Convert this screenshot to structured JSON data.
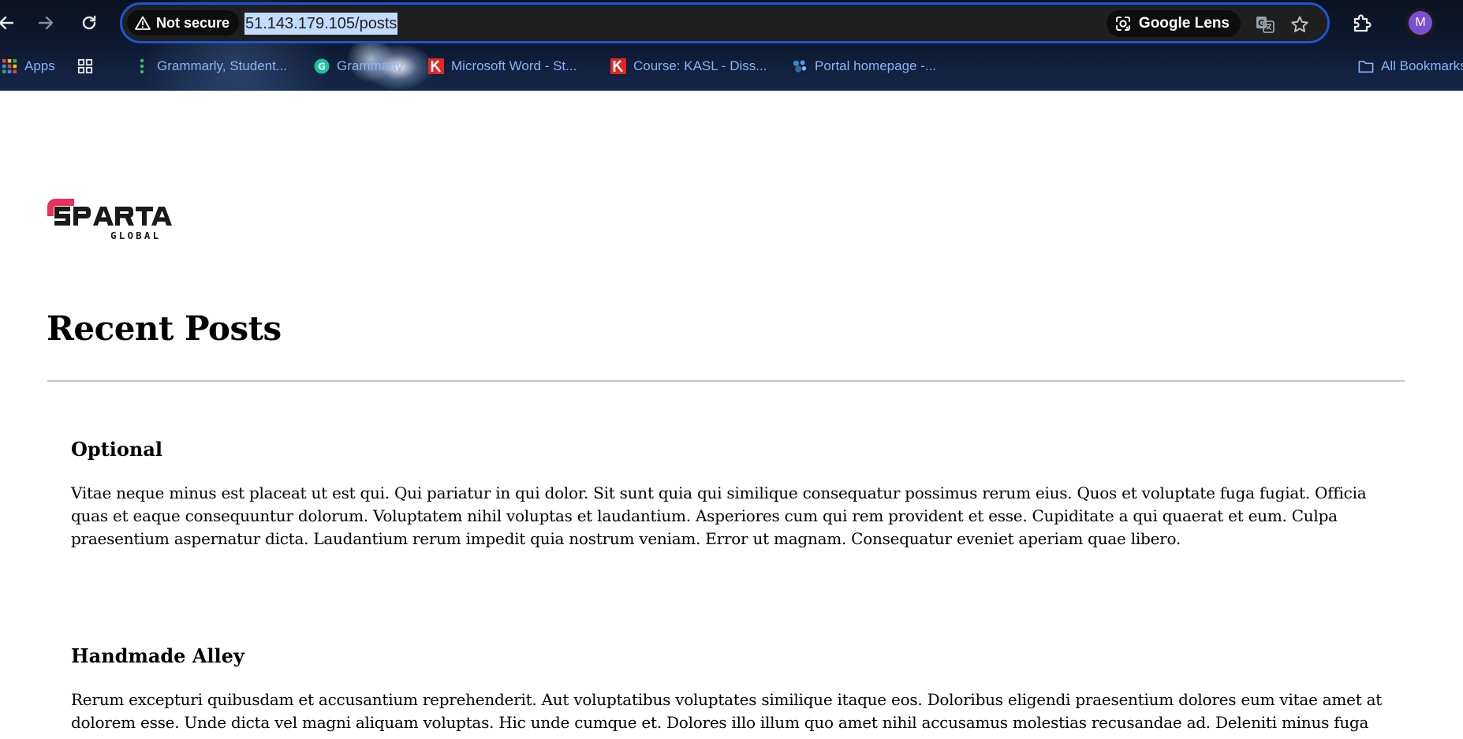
{
  "browser": {
    "security_label": "Not secure",
    "url": "51.143.179.105/posts",
    "lens_label": "Google Lens",
    "profile_initial": "M",
    "bookmarks": [
      {
        "label": "Apps"
      },
      {
        "label": ""
      },
      {
        "label": "Grammarly, Student..."
      },
      {
        "label": "Grammarly"
      },
      {
        "label": "Microsoft Word - St..."
      },
      {
        "label": "Course: KASL - Diss..."
      },
      {
        "label": "Portal homepage -..."
      },
      {
        "label": "All Bookmarks"
      }
    ]
  },
  "page": {
    "logo_alt": "SPARTA GLOBAL",
    "heading": "Recent Posts",
    "posts": [
      {
        "title": "Optional",
        "body": "Vitae neque minus est placeat ut est qui. Qui pariatur in qui dolor. Sit sunt quia qui similique consequatur possimus rerum eius. Quos et voluptate fuga fugiat. Officia quas et eaque consequuntur dolorum. Voluptatem nihil voluptas et laudantium. Asperiores cum qui rem provident et esse. Cupiditate a qui quaerat et eum. Culpa praesentium aspernatur dicta. Laudantium rerum impedit quia nostrum veniam. Error ut magnam. Consequatur eveniet aperiam quae libero."
      },
      {
        "title": "Handmade Alley",
        "body": "Rerum excepturi quibusdam et accusantium reprehenderit. Aut voluptatibus voluptates similique itaque eos. Doloribus eligendi praesentium dolores eum vitae amet at dolorem esse. Unde dicta vel magni aliquam voluptas. Hic unde cumque et. Dolores illo illum quo amet nihil accusamus molestias recusandae ad. Deleniti minus fuga illo voluptatem."
      }
    ]
  },
  "colors": {
    "omnibox_border": "#1a56d6",
    "url_selection": "#c2dbff",
    "bookmark_text": "#8ab4f8",
    "logo_accent": "#e8305a",
    "divider": "#c6c6c6"
  },
  "icons": {
    "back": "arrow-left-icon",
    "forward": "arrow-right-icon",
    "reload": "reload-icon",
    "security": "warning-triangle-icon",
    "lens": "google-lens-icon",
    "translate": "translate-icon",
    "bookmark_star": "star-icon",
    "extensions": "puzzle-icon",
    "folder": "folder-icon"
  }
}
